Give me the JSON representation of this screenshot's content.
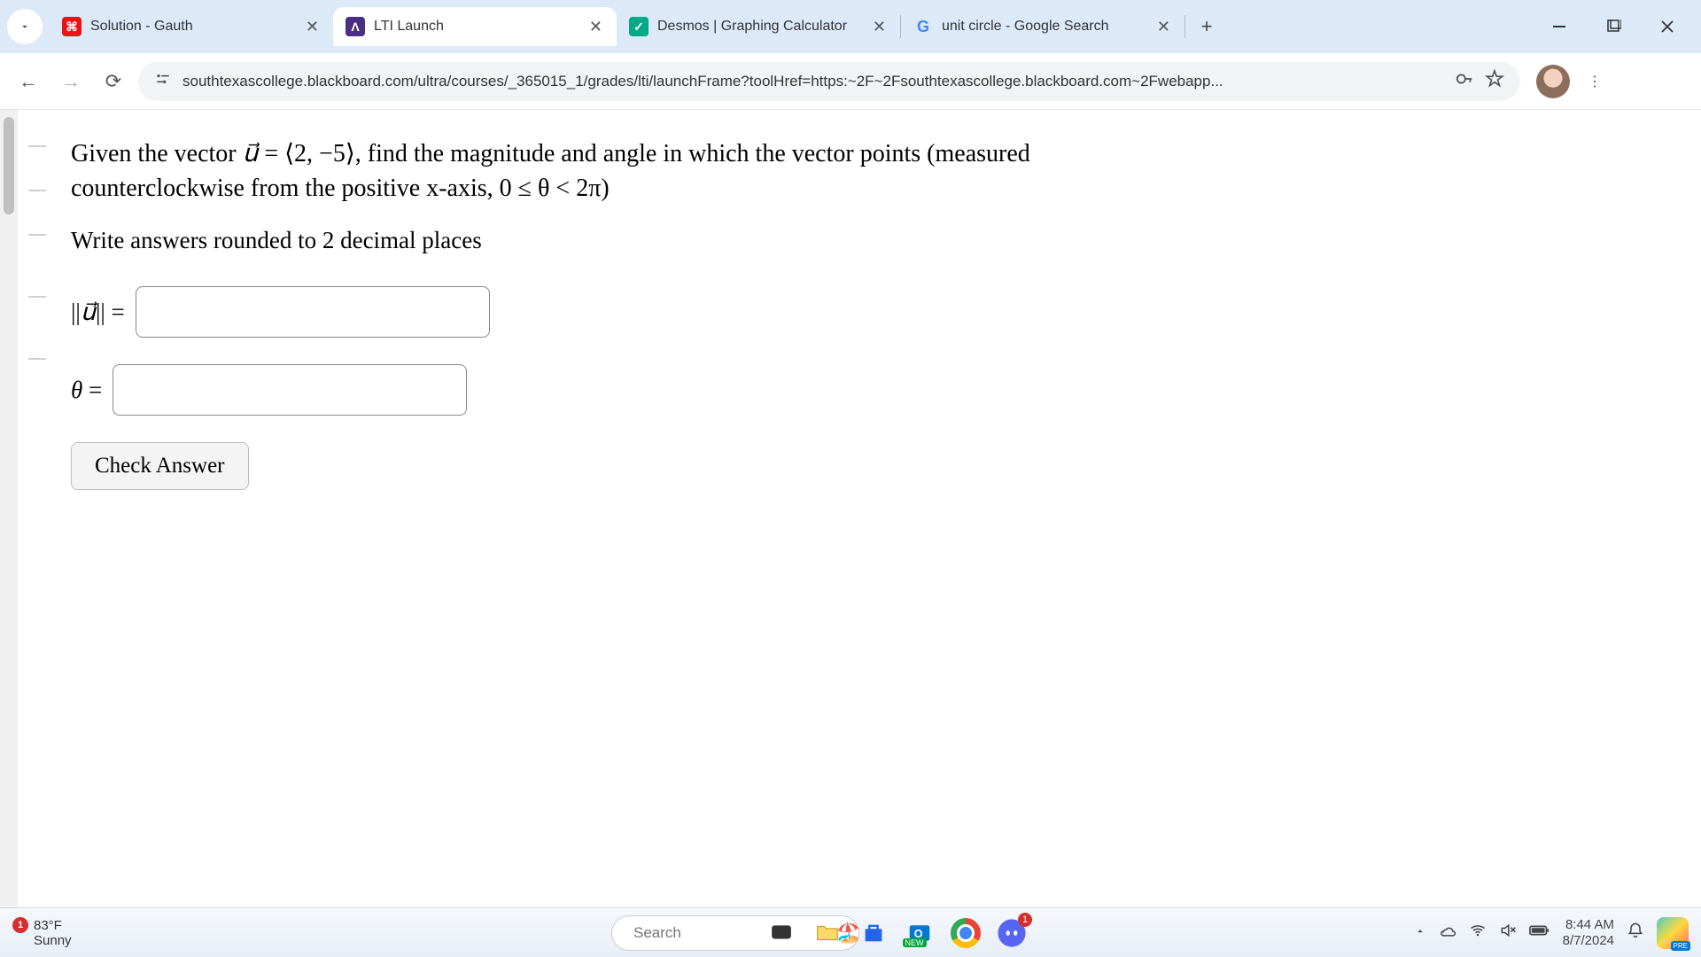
{
  "tabs": [
    {
      "title": "Solution - Gauth",
      "favicon": "G"
    },
    {
      "title": "LTI Launch",
      "favicon": "Λ",
      "active": true
    },
    {
      "title": "Desmos | Graphing Calculator",
      "favicon": "D"
    },
    {
      "title": "unit circle - Google Search",
      "favicon": "G"
    }
  ],
  "url": "southtexascollege.blackboard.com/ultra/courses/_365015_1/grades/lti/launchFrame?toolHref=https:~2F~2Fsouthtexascollege.blackboard.com~2Fwebapp...",
  "problem": {
    "line1_a": "Given the vector ",
    "line1_b": " = ⟨2, −5⟩, find the magnitude and angle in which the vector points (measured",
    "line2": "counterclockwise from the positive x-axis, 0 ≤ θ < 2π)",
    "instruction": "Write answers rounded to 2 decimal places",
    "label_mag_open": "||",
    "label_mag_var": "u⃗",
    "label_mag_close": "||",
    "eq": " = ",
    "label_theta": "θ",
    "check_btn": "Check Answer"
  },
  "taskbar": {
    "temp": "83°F",
    "cond": "Sunny",
    "badge": "1",
    "search_placeholder": "Search",
    "time": "8:44 AM",
    "date": "8/7/2024"
  }
}
